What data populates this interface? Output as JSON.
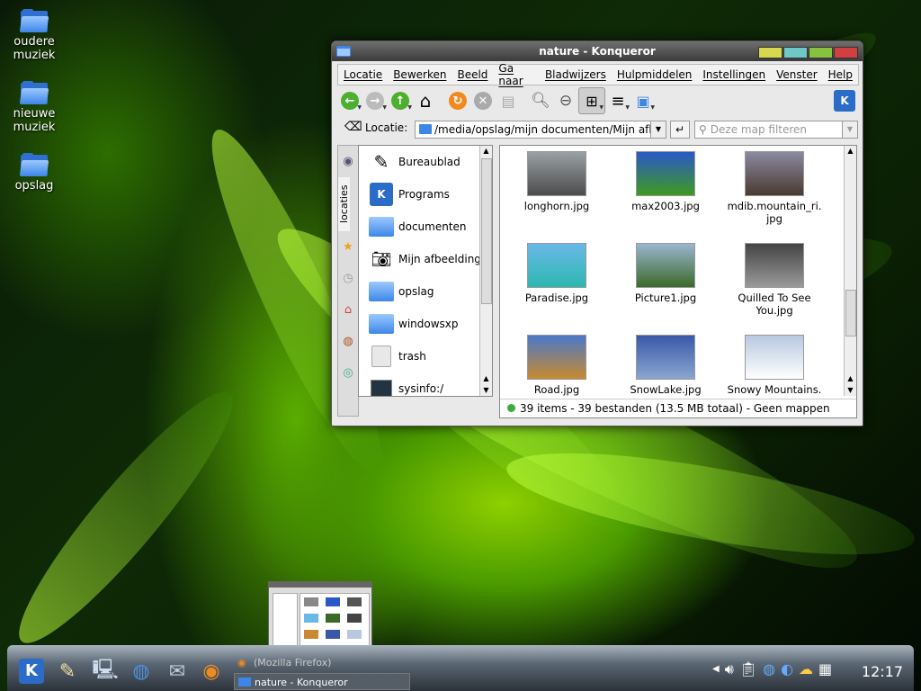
{
  "desktop_icons": [
    {
      "label": "oudere muziek"
    },
    {
      "label": "nieuwe muziek"
    },
    {
      "label": "opslag"
    }
  ],
  "window": {
    "title": "nature - Konqueror"
  },
  "menubar": [
    "Locatie",
    "Bewerken",
    "Beeld",
    "Ga naar",
    "Bladwijzers",
    "Hulpmiddelen",
    "Instellingen",
    "Venster",
    "Help"
  ],
  "locbar": {
    "label": "Locatie:",
    "path": "/media/opslag/mijn documenten/Mijn afbeeld",
    "filter_placeholder": "Deze map filteren"
  },
  "sidebar": {
    "tab_label": "locaties"
  },
  "places": [
    "Bureaublad",
    "Programs",
    "documenten",
    "Mijn afbeeldinge",
    "opslag",
    "windowsxp",
    "trash",
    "sysinfo:/"
  ],
  "files": [
    {
      "name": "longhorn.jpg",
      "colors": [
        "#9aa0a4",
        "#4c4c4c"
      ]
    },
    {
      "name": "max2003.jpg",
      "colors": [
        "#2a58c8",
        "#3f9a20"
      ]
    },
    {
      "name": "mdib.mountain_ri.\njpg",
      "colors": [
        "#8a8aa0",
        "#4a3a30"
      ]
    },
    {
      "name": "Paradise.jpg",
      "colors": [
        "#6ab8e8",
        "#2cb8b0"
      ]
    },
    {
      "name": "Picture1.jpg",
      "colors": [
        "#9ab6d0",
        "#3a6a28"
      ]
    },
    {
      "name": "Quilled To See\nYou.jpg",
      "colors": [
        "#444444",
        "#9a9a9a"
      ]
    },
    {
      "name": "Road.jpg",
      "colors": [
        "#4a78c8",
        "#c88a30"
      ]
    },
    {
      "name": "SnowLake.jpg",
      "colors": [
        "#3a58a8",
        "#8aa6d0"
      ]
    },
    {
      "name": "Snowy Mountains.",
      "colors": [
        "#b8c8e0",
        "#ffffff"
      ]
    }
  ],
  "status": "39 items - 39 bestanden (13.5 MB totaal) - Geen mappen",
  "taskbar": {
    "tasks": [
      "(Mozilla Firefox)",
      "nature - Konqueror"
    ],
    "clock": "12:17"
  }
}
